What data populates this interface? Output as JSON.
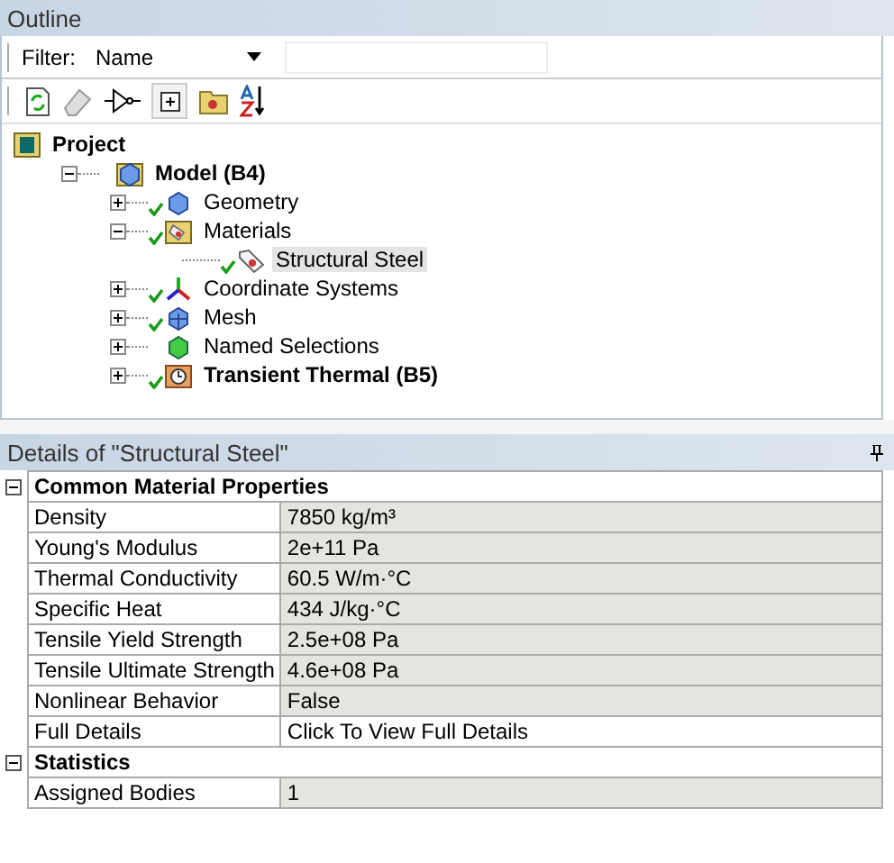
{
  "outline": {
    "title": "Outline",
    "filter_label": "Filter:",
    "filter_value": "Name",
    "tree": [
      {
        "label": "Project",
        "kind": "project",
        "selected": false,
        "children": [
          {
            "label": "Model (B4)",
            "kind": "model",
            "expanded": true,
            "ok": false,
            "selected": false,
            "children": [
              {
                "label": "Geometry",
                "kind": "geometry",
                "expanded": false,
                "ok": true,
                "selected": false
              },
              {
                "label": "Materials",
                "kind": "materials",
                "expanded": true,
                "ok": true,
                "selected": false,
                "children": [
                  {
                    "label": "Structural Steel",
                    "kind": "material",
                    "ok": true,
                    "selected": true
                  }
                ]
              },
              {
                "label": "Coordinate Systems",
                "kind": "coords",
                "expanded": false,
                "ok": true,
                "selected": false
              },
              {
                "label": "Mesh",
                "kind": "mesh",
                "expanded": false,
                "ok": true,
                "selected": false
              },
              {
                "label": "Named Selections",
                "kind": "named",
                "expanded": false,
                "ok": false,
                "selected": false
              },
              {
                "label": "Transient Thermal (B5)",
                "kind": "analysis",
                "expanded": false,
                "ok": true,
                "selected": false
              }
            ]
          }
        ]
      }
    ]
  },
  "details": {
    "title": "Details of \"Structural Steel\"",
    "groups": [
      {
        "label": "Common Material Properties",
        "expanded": true,
        "rows": [
          {
            "name": "Density",
            "value": "7850 kg/m³",
            "read_only": true
          },
          {
            "name": "Young's Modulus",
            "value": "2e+11 Pa",
            "read_only": true
          },
          {
            "name": "Thermal Conductivity",
            "value": "60.5 W/m·°C",
            "read_only": true
          },
          {
            "name": "Specific Heat",
            "value": "434 J/kg·°C",
            "read_only": true
          },
          {
            "name": "Tensile Yield Strength",
            "value": "2.5e+08 Pa",
            "read_only": true
          },
          {
            "name": "Tensile Ultimate Strength",
            "value": "4.6e+08 Pa",
            "read_only": true
          },
          {
            "name": "Nonlinear Behavior",
            "value": "False",
            "read_only": true
          },
          {
            "name": "Full Details",
            "value": "Click To View Full Details",
            "read_only": false
          }
        ]
      },
      {
        "label": "Statistics",
        "expanded": true,
        "rows": [
          {
            "name": "Assigned Bodies",
            "value": "1",
            "read_only": true
          }
        ]
      }
    ]
  }
}
